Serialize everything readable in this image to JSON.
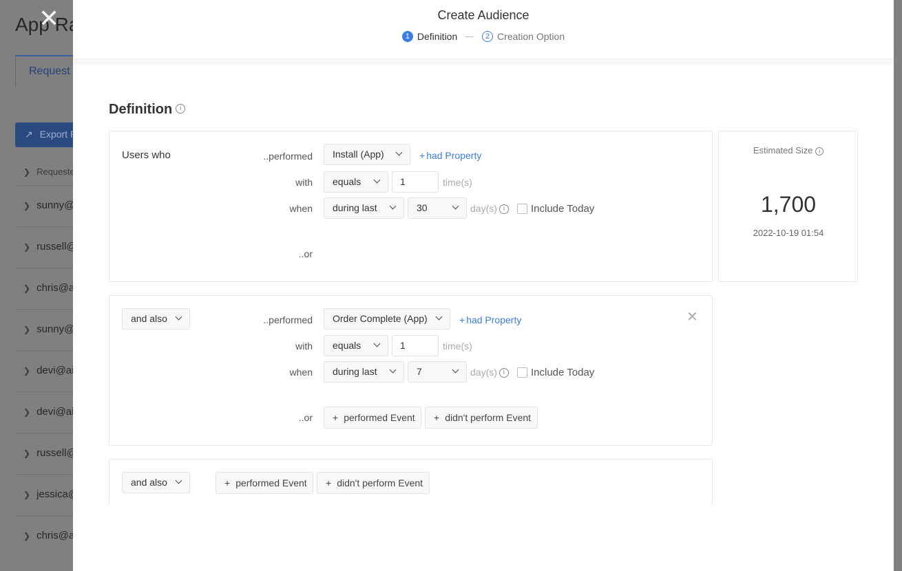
{
  "background": {
    "app_title": "App Ra",
    "tab_label": "Request",
    "export_button": "Export R",
    "list_header": "Requeste",
    "rows": [
      "sunny@ai",
      "russell@",
      "chris@ai",
      "sunny@a",
      "devi@air",
      "devi@air",
      "russell@",
      "jessica@",
      "chris@ai"
    ]
  },
  "modal": {
    "title": "Create Audience",
    "steps": [
      {
        "number": "1",
        "label": "Definition"
      },
      {
        "number": "2",
        "label": "Creation Option"
      }
    ],
    "section_title": "Definition",
    "section_info_icon": "info-icon"
  },
  "condition1": {
    "left_label": "Users who",
    "performed_label": "..performed",
    "event": "Install (App)",
    "had_property": "had Property",
    "with_label": "with",
    "operator": "equals",
    "count": "1",
    "times_unit": "time(s)",
    "when_label": "when",
    "time_range": "during last",
    "days": "30",
    "days_unit": "day(s)",
    "include_today": "Include Today",
    "or_label": "..or"
  },
  "condition2": {
    "combinator": "and also",
    "performed_label": "..performed",
    "event": "Order Complete (App)",
    "had_property": "had Property",
    "with_label": "with",
    "operator": "equals",
    "count": "1",
    "times_unit": "time(s)",
    "when_label": "when",
    "time_range": "during last",
    "days": "7",
    "days_unit": "day(s)",
    "include_today": "Include Today",
    "or_label": "..or",
    "add_performed": "performed Event",
    "add_not_performed": "didn't perform Event"
  },
  "condition3": {
    "combinator": "and also",
    "add_performed": "performed Event",
    "add_not_performed": "didn't perform Event"
  },
  "estimate": {
    "label": "Estimated Size",
    "value": "1,700",
    "timestamp": "2022-10-19 01:54"
  },
  "colors": {
    "accent": "#3b7de3",
    "overlay": "#808080"
  }
}
